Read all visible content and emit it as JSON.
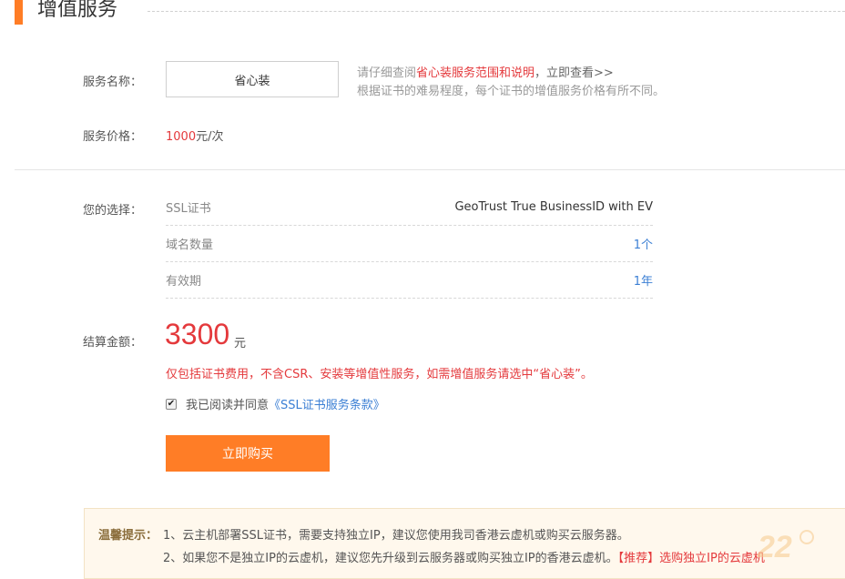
{
  "section": {
    "title": "增值服务"
  },
  "service_name": {
    "label": "服务名称：",
    "value": "省心装",
    "info_prefix": "请仔细查阅",
    "info_highlight": "省心装服务范围和说明",
    "info_more": "，立即查看>>",
    "info_line2": "根据证书的难易程度，每个证书的增值服务价格有所不同。"
  },
  "service_price": {
    "label": "服务价格：",
    "amount": "1000",
    "unit": "元/次"
  },
  "selection": {
    "label": "您的选择：",
    "rows": [
      {
        "key": "SSL证书",
        "value": "GeoTrust True BusinessID with EV"
      },
      {
        "key": "域名数量",
        "value": "1个"
      },
      {
        "key": "有效期",
        "value": "1年"
      }
    ]
  },
  "total": {
    "label": "结算金额：",
    "amount": "3300",
    "unit": "元"
  },
  "warning": "仅包括证书费用，不含CSR、安装等增值性服务，如需增值服务请选中“省心装”。",
  "agreement": {
    "checked": true,
    "check_glyph": "✔",
    "text": "我已阅读并同意",
    "link": "《SSL证书服务条款》"
  },
  "buy_button": "立即购买",
  "tips": {
    "title": "温馨提示：",
    "line1": "1、云主机部署SSL证书，需要支持独立IP，建议您使用我司香港云虚机或购买云服务器。",
    "line2": "2、如果您不是独立IP的云虚机，建议您先升级到云服务器或购买独立IP的香港云虚机。",
    "recommend_tag": "【推荐】",
    "recommend_link": "选购独立IP的云虚机"
  },
  "colors": {
    "accent": "#ff7d26",
    "price_red": "#e4393c",
    "link_blue": "#3b7fd4",
    "tips_bg": "#fff8ed"
  },
  "icons": {
    "checkbox": "checkbox-checked-icon",
    "watermark": "watermark-logo-icon"
  },
  "watermark_text": "22"
}
